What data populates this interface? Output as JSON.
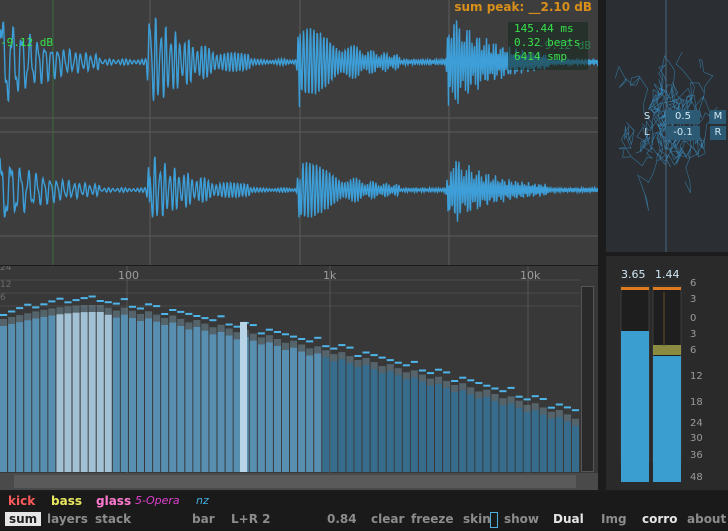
{
  "oscilloscope": {
    "peak_label": "sum peak: __2.10 dB",
    "level_label": "-9.12 dB",
    "cursor_readout": [
      "145.44 ms",
      "0.32 beats",
      "6414 smp"
    ],
    "ghost_db": "-9.12 dB",
    "wave_color": "#3d9ed8",
    "grid_color": "#5a5a5a"
  },
  "spectrum": {
    "freq_labels": [
      "100",
      "1k",
      "10k"
    ],
    "db_ticks": [
      "24",
      "12",
      "6"
    ],
    "bar_color_bright": "#a8c8dc",
    "bar_color_mid": "#5e9ec4",
    "bar_color_dark": "#37759b"
  },
  "vectorscope": {
    "s_label": "S",
    "s_value": "0.5",
    "m_label": "M",
    "l_label": "L",
    "l_value": "-0.1",
    "r_label": "R"
  },
  "meter": {
    "left_value": "3.65",
    "right_value": "1.44",
    "scale": [
      "6",
      "3",
      "0",
      "3",
      "6",
      "12",
      "18",
      "24",
      "30",
      "36",
      "48"
    ],
    "peak_color": "#e07a20",
    "fill_color": "#3a9fd0"
  },
  "legend": [
    {
      "label": "kick",
      "color": "#ff5a5a",
      "style": "bold"
    },
    {
      "label": "bass",
      "color": "#e8e860",
      "style": "bold"
    },
    {
      "label": "glass",
      "color": "#ff7ad0",
      "style": "bold"
    },
    {
      "label": "5-Opera",
      "color": "#e040d0",
      "style": "italic"
    },
    {
      "label": "nz",
      "color": "#40b0e0",
      "style": "italic"
    }
  ],
  "toolbar": {
    "sum": "sum",
    "layers": "layers",
    "stack": "stack",
    "bar": "bar",
    "lr": "L+R 2",
    "value": "0.84",
    "clear": "clear",
    "freeze": "freeze",
    "skin": "skin",
    "show": "show",
    "dual": "Dual",
    "img": "Img",
    "corro": "corro",
    "about": "about"
  }
}
